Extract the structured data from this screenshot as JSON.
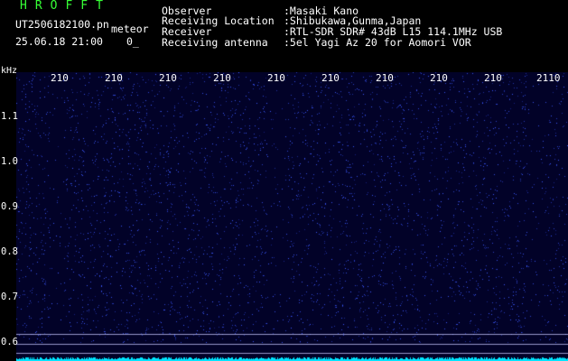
{
  "header": {
    "brand": "HROFFT",
    "filename": "UT2506182100.pn",
    "mode_label": "meteor",
    "datetime": "25.06.18 21:00",
    "count": "0_"
  },
  "info": [
    {
      "label": "Observer",
      "value": ":Masaki Kano"
    },
    {
      "label": "Receiving Location",
      "value": ":Shibukawa,Gunma,Japan"
    },
    {
      "label": "Receiver",
      "value": ":RTL-SDR SDR# 43dB L15 114.1MHz USB"
    },
    {
      "label": "Receiving antenna",
      "value": ":5el Yagi Az 20 for Aomori VOR"
    }
  ],
  "axis": {
    "unit": "kHz",
    "time_ticks": [
      "210",
      "210",
      "210",
      "210",
      "210",
      "210",
      "210",
      "210",
      "210",
      "2110"
    ],
    "freq_ticks": [
      "1.1",
      "1.0",
      "0.9",
      "0.8",
      "0.7",
      "0.6"
    ]
  },
  "colors": {
    "background": "#000000",
    "brand": "#36ff36",
    "spectrum_bg": "#020228",
    "noise": "#3a4cff",
    "baseline": "#00e5ff"
  }
}
